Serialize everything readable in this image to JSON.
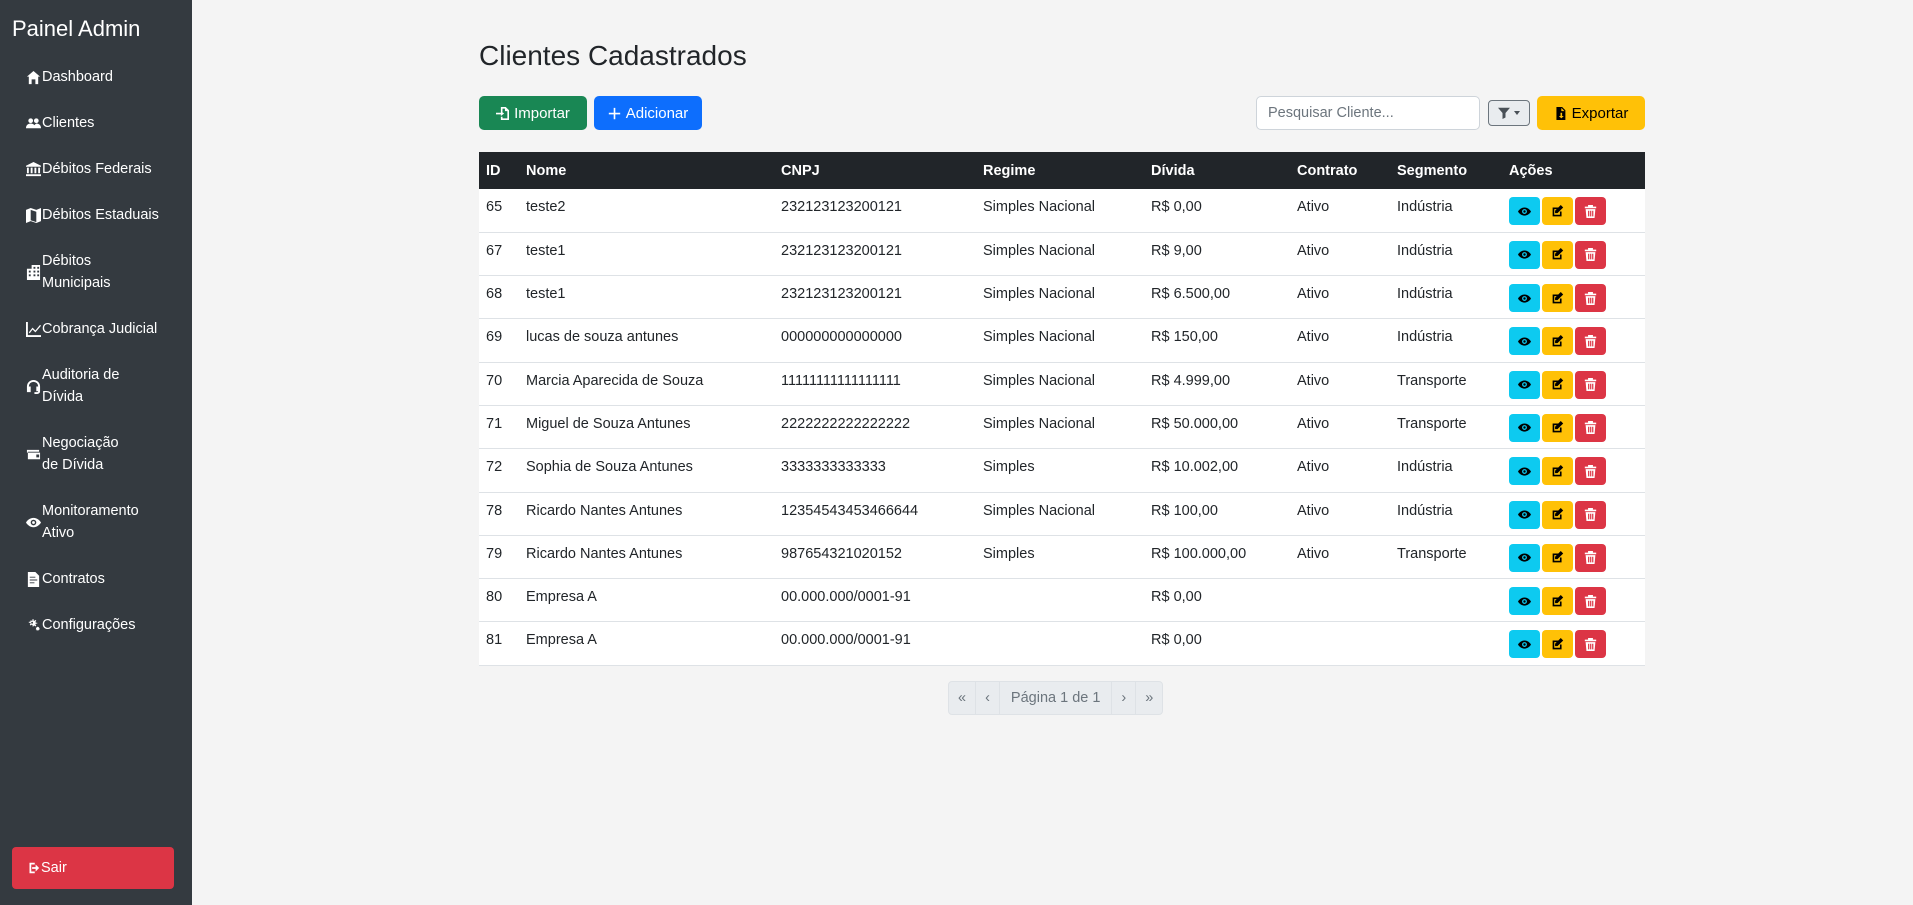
{
  "sidebar": {
    "brand": "Painel Admin",
    "items": [
      {
        "label": "Dashboard",
        "icon": "home-icon"
      },
      {
        "label": "Clientes",
        "icon": "users-icon"
      },
      {
        "label": "Débitos Federais",
        "icon": "bank-icon"
      },
      {
        "label": "Débitos Estaduais",
        "icon": "map-icon"
      },
      {
        "label": "Débitos Municipais",
        "icon": "city-icon"
      },
      {
        "label": "Cobrança Judicial",
        "icon": "chart-line-icon"
      },
      {
        "label": "Auditoria de Dívida",
        "icon": "headset-icon"
      },
      {
        "label": "Negociação de Dívida",
        "icon": "wallet-icon"
      },
      {
        "label": "Monitoramento Ativo",
        "icon": "eye-icon"
      },
      {
        "label": "Contratos",
        "icon": "contract-icon"
      },
      {
        "label": "Configurações",
        "icon": "gears-icon"
      }
    ],
    "logout": "Sair"
  },
  "main": {
    "title": "Clientes Cadastrados",
    "import_label": "Importar",
    "add_label": "Adicionar",
    "search_placeholder": "Pesquisar Cliente...",
    "export_label": "Exportar"
  },
  "table": {
    "headers": [
      "ID",
      "Nome",
      "CNPJ",
      "Regime",
      "Dívida",
      "Contrato",
      "Segmento",
      "Ações"
    ],
    "rows": [
      [
        "65",
        "teste2",
        "232123123200121",
        "Simples Nacional",
        "R$ 0,00",
        "Ativo",
        "Indústria"
      ],
      [
        "67",
        "teste1",
        "232123123200121",
        "Simples Nacional",
        "R$ 9,00",
        "Ativo",
        "Indústria"
      ],
      [
        "68",
        "teste1",
        "232123123200121",
        "Simples Nacional",
        "R$ 6.500,00",
        "Ativo",
        "Indústria"
      ],
      [
        "69",
        "lucas de souza antunes",
        "000000000000000",
        "Simples Nacional",
        "R$ 150,00",
        "Ativo",
        "Indústria"
      ],
      [
        "70",
        "Marcia Aparecida de Souza",
        "11111111111111111",
        "Simples Nacional",
        "R$ 4.999,00",
        "Ativo",
        "Transporte"
      ],
      [
        "71",
        "Miguel de Souza Antunes",
        "2222222222222222",
        "Simples Nacional",
        "R$ 50.000,00",
        "Ativo",
        "Transporte"
      ],
      [
        "72",
        "Sophia de Souza Antunes",
        "3333333333333",
        "Simples",
        "R$ 10.002,00",
        "Ativo",
        "Indústria"
      ],
      [
        "78",
        "Ricardo Nantes Antunes",
        "12354543453466644",
        "Simples Nacional",
        "R$ 100,00",
        "Ativo",
        "Indústria"
      ],
      [
        "79",
        "Ricardo Nantes Antunes",
        "987654321020152",
        "Simples",
        "R$ 100.000,00",
        "Ativo",
        "Transporte"
      ],
      [
        "80",
        "Empresa A",
        "00.000.000/0001-91",
        "",
        "R$ 0,00",
        "",
        ""
      ],
      [
        "81",
        "Empresa A",
        "00.000.000/0001-91",
        "",
        "R$ 0,00",
        "",
        ""
      ]
    ]
  },
  "pagination": {
    "first": "«",
    "prev": "‹",
    "info": "Página 1 de 1",
    "next": "›",
    "last": "»"
  },
  "colors": {
    "sidebar_bg": "#343a40",
    "logout_bg": "#dc3545",
    "import_bg": "#198754",
    "add_bg": "#0d6efd",
    "export_bg": "#ffc107",
    "table_header_bg": "#212529",
    "view_bg": "#0dcaf0",
    "edit_bg": "#ffc107",
    "delete_bg": "#dc3545"
  }
}
